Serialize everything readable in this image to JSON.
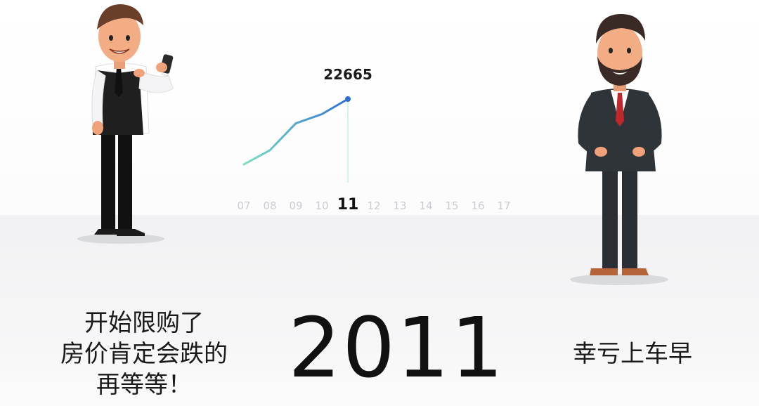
{
  "chart_data": {
    "type": "line",
    "categories": [
      "07",
      "08",
      "09",
      "10",
      "11",
      "12",
      "13",
      "14",
      "15",
      "16",
      "17"
    ],
    "active_category": "11",
    "values": [
      12000,
      14300,
      18700,
      20200,
      22665
    ],
    "value_label": "22665",
    "colors": {
      "line_start": "#7ee0c4",
      "line_end": "#2e6fd6",
      "tick": "#c9ccd2",
      "active_tick": "#111111"
    }
  },
  "captions": {
    "left_lines": [
      "开始限购了",
      "房价肯定会跌的",
      "再等等！"
    ],
    "year": "2011",
    "right": "幸亏上车早"
  },
  "figures": {
    "left": "man-pointing-at-phone",
    "right": "bearded-man-in-suit"
  }
}
